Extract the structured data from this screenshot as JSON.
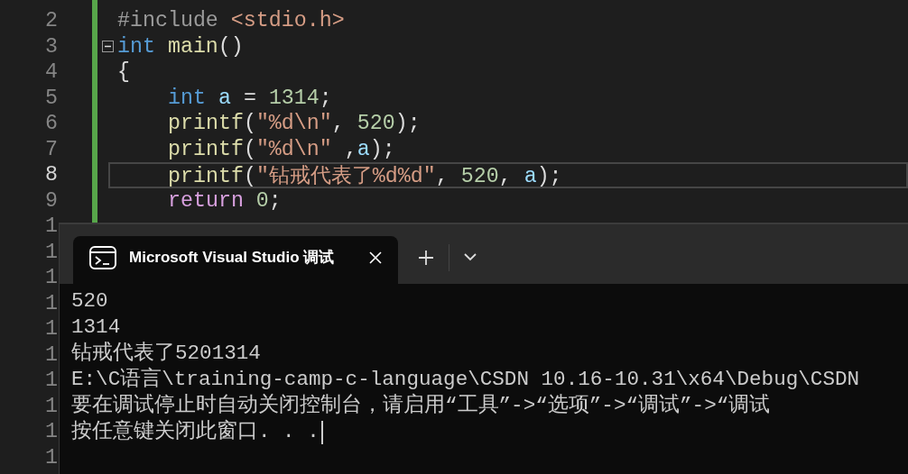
{
  "editor": {
    "lines": [
      {
        "number": "2",
        "foldable": false,
        "current": false,
        "indented": false,
        "code": [
          {
            "kind": "preprocessor",
            "text": "#include "
          },
          {
            "kind": "string",
            "text": "<stdio.h>"
          }
        ]
      },
      {
        "number": "3",
        "foldable": true,
        "current": false,
        "indented": false,
        "code": [
          {
            "kind": "keyword",
            "text": "int"
          },
          {
            "kind": "function",
            "text": " main"
          },
          {
            "kind": "plain",
            "text": "()"
          }
        ]
      },
      {
        "number": "4",
        "foldable": false,
        "current": false,
        "indented": false,
        "code": [
          {
            "kind": "plain",
            "text": "{"
          }
        ]
      },
      {
        "number": "5",
        "foldable": false,
        "current": false,
        "indented": true,
        "code": [
          {
            "kind": "keyword",
            "text": "int"
          },
          {
            "kind": "variable",
            "text": " a"
          },
          {
            "kind": "plain",
            "text": " = "
          },
          {
            "kind": "number",
            "text": "1314"
          },
          {
            "kind": "plain",
            "text": ";"
          }
        ]
      },
      {
        "number": "6",
        "foldable": false,
        "current": false,
        "indented": true,
        "code": [
          {
            "kind": "function",
            "text": "printf"
          },
          {
            "kind": "plain",
            "text": "("
          },
          {
            "kind": "string",
            "text": "\"%d\\n\""
          },
          {
            "kind": "plain",
            "text": ", "
          },
          {
            "kind": "number",
            "text": "520"
          },
          {
            "kind": "plain",
            "text": ");"
          }
        ]
      },
      {
        "number": "7",
        "foldable": false,
        "current": false,
        "indented": true,
        "code": [
          {
            "kind": "function",
            "text": "printf"
          },
          {
            "kind": "plain",
            "text": "("
          },
          {
            "kind": "string",
            "text": "\"%d\\n\""
          },
          {
            "kind": "plain",
            "text": " ,"
          },
          {
            "kind": "variable",
            "text": "a"
          },
          {
            "kind": "plain",
            "text": ");"
          }
        ]
      },
      {
        "number": "8",
        "foldable": false,
        "current": true,
        "indented": true,
        "code": [
          {
            "kind": "function",
            "text": "printf"
          },
          {
            "kind": "plain",
            "text": "("
          },
          {
            "kind": "string",
            "text": "\"钻戒代表了%d%d\""
          },
          {
            "kind": "plain",
            "text": ", "
          },
          {
            "kind": "number",
            "text": "520"
          },
          {
            "kind": "plain",
            "text": ", "
          },
          {
            "kind": "variable",
            "text": "a"
          },
          {
            "kind": "plain",
            "text": ");"
          }
        ]
      },
      {
        "number": "9",
        "foldable": false,
        "current": false,
        "indented": true,
        "code": [
          {
            "kind": "control",
            "text": "return"
          },
          {
            "kind": "number",
            "text": " 0"
          },
          {
            "kind": "plain",
            "text": ";"
          }
        ]
      },
      {
        "number": "1",
        "foldable": false,
        "current": false,
        "indented": false
      },
      {
        "number": "1",
        "foldable": false,
        "current": false,
        "indented": false
      },
      {
        "number": "1",
        "foldable": false,
        "current": false,
        "indented": false
      },
      {
        "number": "1",
        "foldable": false,
        "current": false,
        "indented": false
      },
      {
        "number": "1",
        "foldable": false,
        "current": false,
        "indented": false
      },
      {
        "number": "1",
        "foldable": false,
        "current": false,
        "indented": false
      },
      {
        "number": "1",
        "foldable": false,
        "current": false,
        "indented": false
      },
      {
        "number": "1",
        "foldable": false,
        "current": false,
        "indented": false
      },
      {
        "number": "1",
        "foldable": false,
        "current": false,
        "indented": false
      },
      {
        "number": "1",
        "foldable": false,
        "current": false,
        "indented": false
      }
    ]
  },
  "console": {
    "tabs": [
      {
        "title": "Microsoft Visual Studio 调试",
        "selected": true
      }
    ],
    "output": [
      "520",
      "1314",
      "钻戒代表了5201314",
      "E:\\C语言\\training-camp-c-language\\CSDN 10.16-10.31\\x64\\Debug\\CSDN",
      "要在调试停止时自动关闭控制台，请启用“工具”->“选项”->“调试”->“调试",
      "按任意键关闭此窗口. . ."
    ]
  }
}
